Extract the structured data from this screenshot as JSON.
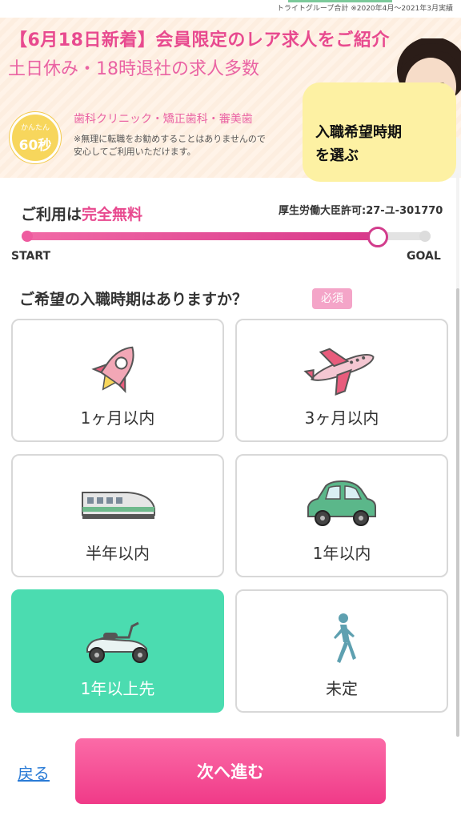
{
  "header": {
    "note": "トライトグループ合計 ※2020年4月〜2021年3月実績"
  },
  "banner": {
    "title": "【6月18日新着】会員限定のレア求人をご紹介",
    "subtitle": "土日休み・18時退社の求人多数",
    "badge_top": "かんたん",
    "badge_main": "60秒",
    "tags": "歯科クリニック・矯正歯科・審美歯",
    "note_line1": "※無理に転職をお勧めすることはありませんので",
    "note_line2": "安心してご利用いただけます。"
  },
  "callout": {
    "line1": "入職希望時期",
    "line2": "を選ぶ"
  },
  "usage": {
    "prefix": "ご利用は",
    "highlight": "完全無料"
  },
  "license": "厚生労働大臣許可:27-ユ-301770",
  "progress": {
    "start_label": "START",
    "goal_label": "GOAL",
    "value": 0.87
  },
  "question": {
    "text": "ご希望の入職時期はありますか？",
    "required": "必須"
  },
  "options": [
    {
      "label": "1ヶ月以内",
      "icon": "rocket-icon",
      "selected": false
    },
    {
      "label": "3ヶ月以内",
      "icon": "airplane-icon",
      "selected": false
    },
    {
      "label": "半年以内",
      "icon": "bullet-train-icon",
      "selected": false
    },
    {
      "label": "1年以内",
      "icon": "car-icon",
      "selected": false
    },
    {
      "label": "1年以上先",
      "icon": "scooter-icon",
      "selected": true
    },
    {
      "label": "未定",
      "icon": "walking-person-icon",
      "selected": false
    }
  ],
  "nav": {
    "back_label": "戻る",
    "next_label": "次へ進む"
  },
  "colors": {
    "accent_pink": "#e84a8f",
    "selected_green": "#4bdcb0",
    "callout_yellow": "#fdf1a3"
  }
}
